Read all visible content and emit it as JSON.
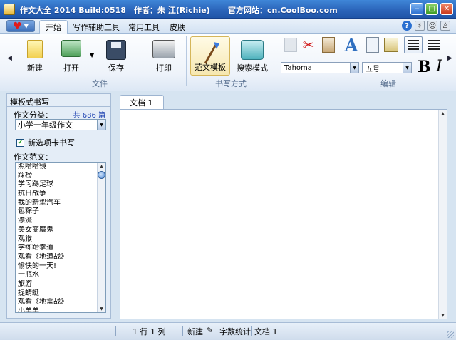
{
  "window": {
    "title_app": "作文大全 2014 Build:0518",
    "title_author": "作者：朱 江(Richie)",
    "title_site": "官方网站：cn.CoolBoo.com"
  },
  "tabs": [
    {
      "label": "开始",
      "active": true
    },
    {
      "label": "写作辅助工具",
      "active": false
    },
    {
      "label": "常用工具",
      "active": false
    },
    {
      "label": "皮肤",
      "active": false
    }
  ],
  "ribbon": {
    "file_group": {
      "label": "文件",
      "new": "新建",
      "open": "打开",
      "save": "保存",
      "print": "打印"
    },
    "writing_group": {
      "label": "书写方式",
      "template_mode": "范文模板",
      "search_mode": "搜索模式"
    },
    "edit_group": {
      "label": "编辑",
      "font_name": "Tahoma",
      "font_size": "五号",
      "bold": "B",
      "font_color": "A"
    }
  },
  "left_panel": {
    "title": "模板式书写",
    "category_label": "作文分类：",
    "count_text": "共 686 篇",
    "category_selected": "小学一年级作文",
    "new_tab_checkbox_label": "新选项卡书写",
    "new_tab_checked": true,
    "samples_label": "作文范文：",
    "samples": [
      "照哈哈镜",
      "踩榜",
      "学习踢足球",
      "抗日战争",
      "我的新型汽车",
      "包粽子",
      "漂流",
      "美女变魔鬼",
      "观猴",
      "学练跆拳道",
      "观看《地道战》",
      "愉快的一天!",
      "一瓶水",
      "旅游",
      "捉蜻蜓",
      "观看《地雷战》",
      "小羊羊"
    ]
  },
  "document": {
    "tab_label": "文档 1",
    "content": ""
  },
  "statusbar": {
    "position": "1 行  1 列",
    "mode": "新建",
    "word_count": "字数统计",
    "doc_name": "文档 1"
  },
  "colors": {
    "titlebar": "#2a63b8",
    "accent_blue": "#1a3fb0",
    "panel_bg": "#e4edf7"
  }
}
